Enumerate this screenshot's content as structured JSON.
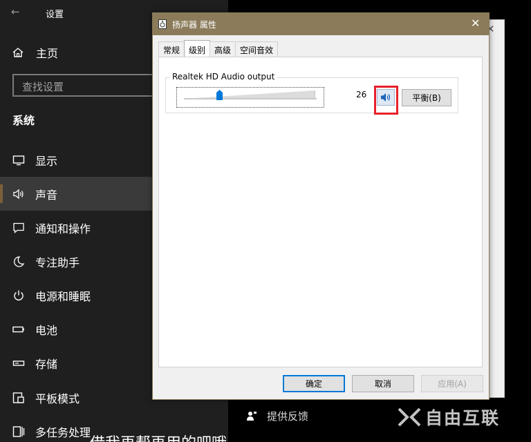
{
  "settings": {
    "title": "设置",
    "home_label": "主页",
    "search_placeholder": "查找设置",
    "section_title": "系统",
    "nav_items": [
      {
        "label": "显示",
        "icon": "monitor-icon"
      },
      {
        "label": "声音",
        "icon": "speaker-icon"
      },
      {
        "label": "通知和操作",
        "icon": "notification-icon"
      },
      {
        "label": "专注助手",
        "icon": "moon-icon"
      },
      {
        "label": "电源和睡眠",
        "icon": "power-icon"
      },
      {
        "label": "电池",
        "icon": "battery-icon"
      },
      {
        "label": "存储",
        "icon": "storage-icon"
      },
      {
        "label": "平板模式",
        "icon": "tablet-icon"
      },
      {
        "label": "多任务处理",
        "icon": "multitask-icon"
      }
    ],
    "selected_nav": "声音",
    "feedback_label": "提供反馈"
  },
  "dialog": {
    "title": "扬声器 属性",
    "tabs": [
      {
        "label": "常规"
      },
      {
        "label": "级别"
      },
      {
        "label": "高级"
      },
      {
        "label": "空间音效"
      }
    ],
    "active_tab": "级别",
    "device_name": "Realtek HD Audio output",
    "volume_value": "26",
    "balance_button": "平衡(B)",
    "ok_button": "确定",
    "cancel_button": "取消",
    "apply_button": "应用(A)"
  },
  "overlay": {
    "watermark_text": "自由互联",
    "subtitle_text": "借我再帮再用的吧哦"
  },
  "colors": {
    "sidebar_bg": "#1f1f1f",
    "selected_bg": "#3a3a3a",
    "accent": "#7b5f3a",
    "dialog_title_bg": "#8b7b5a",
    "highlight": "#e8202a",
    "focus_blue": "#0078d7"
  }
}
